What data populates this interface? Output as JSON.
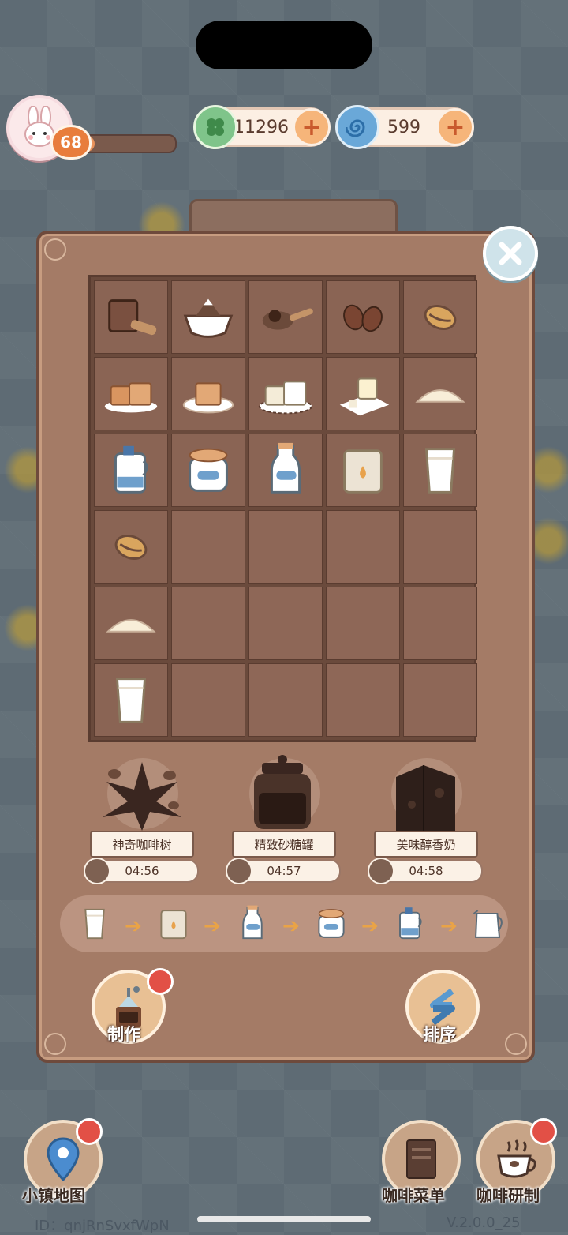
{
  "hud": {
    "level": "68",
    "xp_progress": 0.18,
    "leaf_currency": "11296",
    "swirl_currency": "599"
  },
  "inventory": {
    "rows": [
      [
        "mug-milk-pitcher",
        "latte-cup",
        "coffee-scoop",
        "coffee-beans",
        "coffee-bean"
      ],
      [
        "brown-sugar-cubes",
        "brown-sugar-plate",
        "white-sugar-cubes",
        "sugar-cube-napkin",
        "sugar-powder"
      ],
      [
        "milk-jug",
        "milk-jar",
        "milk-bottle",
        "milk-bag",
        "milk-glass"
      ],
      [
        "coffee-bean",
        "",
        "",
        "",
        ""
      ],
      [
        "sugar-powder",
        "",
        "",
        "",
        ""
      ],
      [
        "milk-glass",
        "",
        "",
        "",
        ""
      ]
    ]
  },
  "producers": [
    {
      "name": "神奇咖啡树",
      "timer": "04:56",
      "icon": "coffee-tree"
    },
    {
      "name": "精致砂糖罐",
      "timer": "04:57",
      "icon": "sugar-jar"
    },
    {
      "name": "美味醇香奶",
      "timer": "04:58",
      "icon": "milk-carton"
    }
  ],
  "chain": [
    "milk-glass",
    "milk-bag",
    "milk-bottle",
    "milk-jar",
    "milk-jug",
    "milk-pitcher"
  ],
  "actions": {
    "craft_label": "制作",
    "sort_label": "排序"
  },
  "bottom_nav": {
    "map_label": "小镇地图",
    "menu_label": "咖啡菜单",
    "research_label": "咖啡研制"
  },
  "footer": {
    "id_text": "ID：qnjRnSvxfWpN",
    "version": "V.2.0.0_25"
  },
  "colors": {
    "panel": "#a47b66",
    "grid_cell": "#8a6454",
    "accent_orange": "#e8915a",
    "red_badge": "#e25046"
  }
}
